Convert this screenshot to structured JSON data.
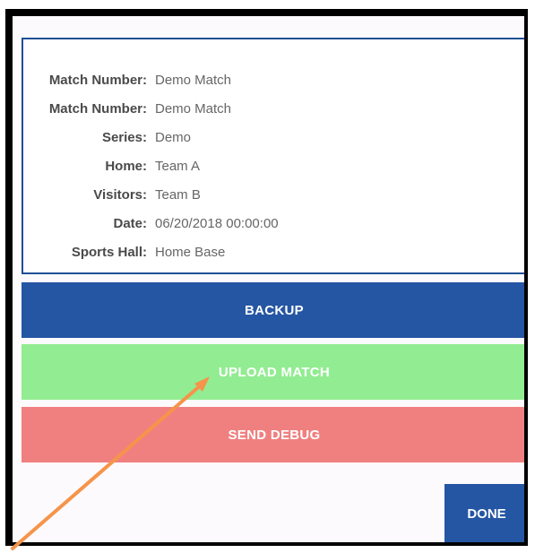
{
  "match_info": [
    {
      "label": "Match Number:",
      "value": "Demo Match"
    },
    {
      "label": "Match Number:",
      "value": "Demo Match"
    },
    {
      "label": "Series:",
      "value": "Demo"
    },
    {
      "label": "Home:",
      "value": "Team A"
    },
    {
      "label": "Visitors:",
      "value": "Team B"
    },
    {
      "label": "Date:",
      "value": "06/20/2018 00:00:00"
    },
    {
      "label": "Sports Hall:",
      "value": "Home Base"
    }
  ],
  "buttons": {
    "backup": "BACKUP",
    "upload": "UPLOAD MATCH",
    "debug": "SEND DEBUG",
    "done": "DONE"
  },
  "colors": {
    "backup": "#2556a3",
    "upload": "#92ec92",
    "debug": "#f08080",
    "done": "#2556a3",
    "card_border": "#1f4f96",
    "annotation_arrow": "#f5944a"
  },
  "annotation": {
    "icon": "arrow-annotation-icon",
    "points_to": "upload-match-button"
  }
}
